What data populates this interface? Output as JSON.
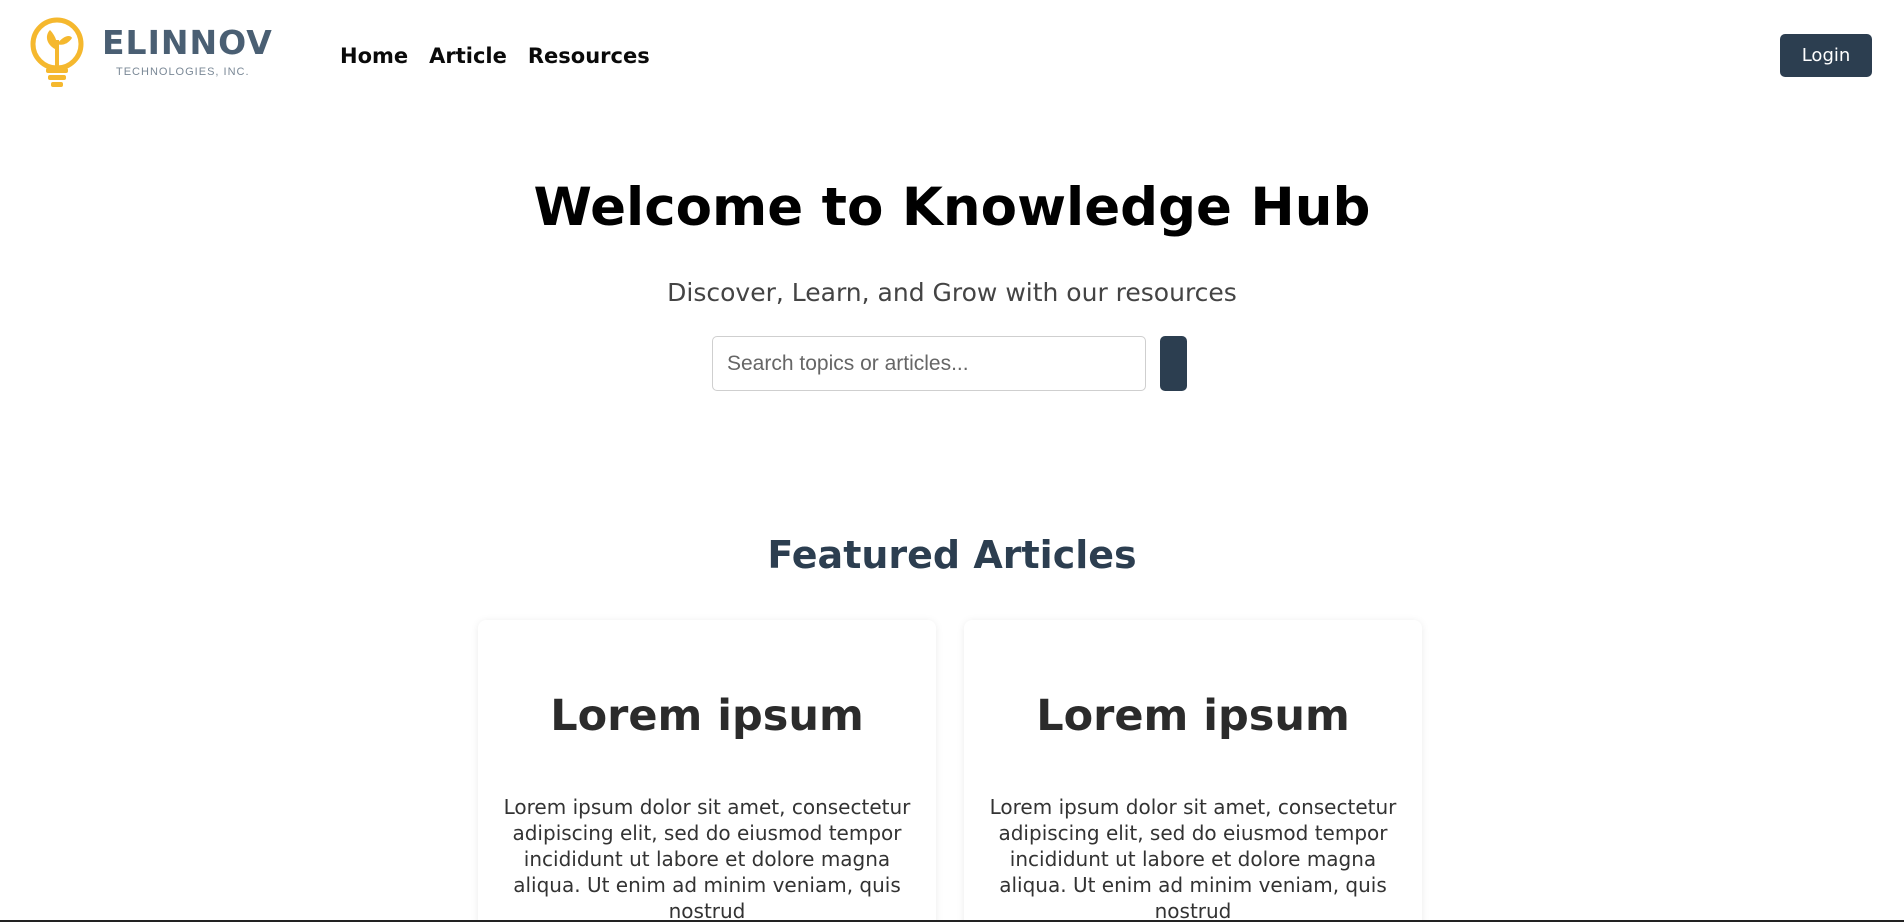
{
  "brand": {
    "name": "ELINNOV",
    "subtitle": "TECHNOLOGIES, INC.",
    "accent_color": "#f5b82e",
    "text_color": "#4a5f73"
  },
  "nav": {
    "items": [
      {
        "label": "Home"
      },
      {
        "label": "Article"
      },
      {
        "label": "Resources"
      }
    ]
  },
  "header": {
    "login_label": "Login",
    "button_color": "#2c3e50"
  },
  "hero": {
    "title": "Welcome to Knowledge Hub",
    "subtitle": "Discover, Learn, and Grow with our resources"
  },
  "search": {
    "placeholder": "Search topics or articles...",
    "value": ""
  },
  "featured": {
    "title": "Featured Articles",
    "cards": [
      {
        "title": "Lorem ipsum",
        "body": "Lorem ipsum dolor sit amet, consectetur adipiscing elit, sed do eiusmod tempor incididunt ut labore et dolore magna aliqua. Ut enim ad minim veniam, quis nostrud"
      },
      {
        "title": "Lorem ipsum",
        "body": "Lorem ipsum dolor sit amet, consectetur adipiscing elit, sed do eiusmod tempor incididunt ut labore et dolore magna aliqua. Ut enim ad minim veniam, quis nostrud"
      }
    ]
  },
  "icons": {
    "logo": "lightbulb-plant-icon",
    "search_button": "search-icon"
  }
}
